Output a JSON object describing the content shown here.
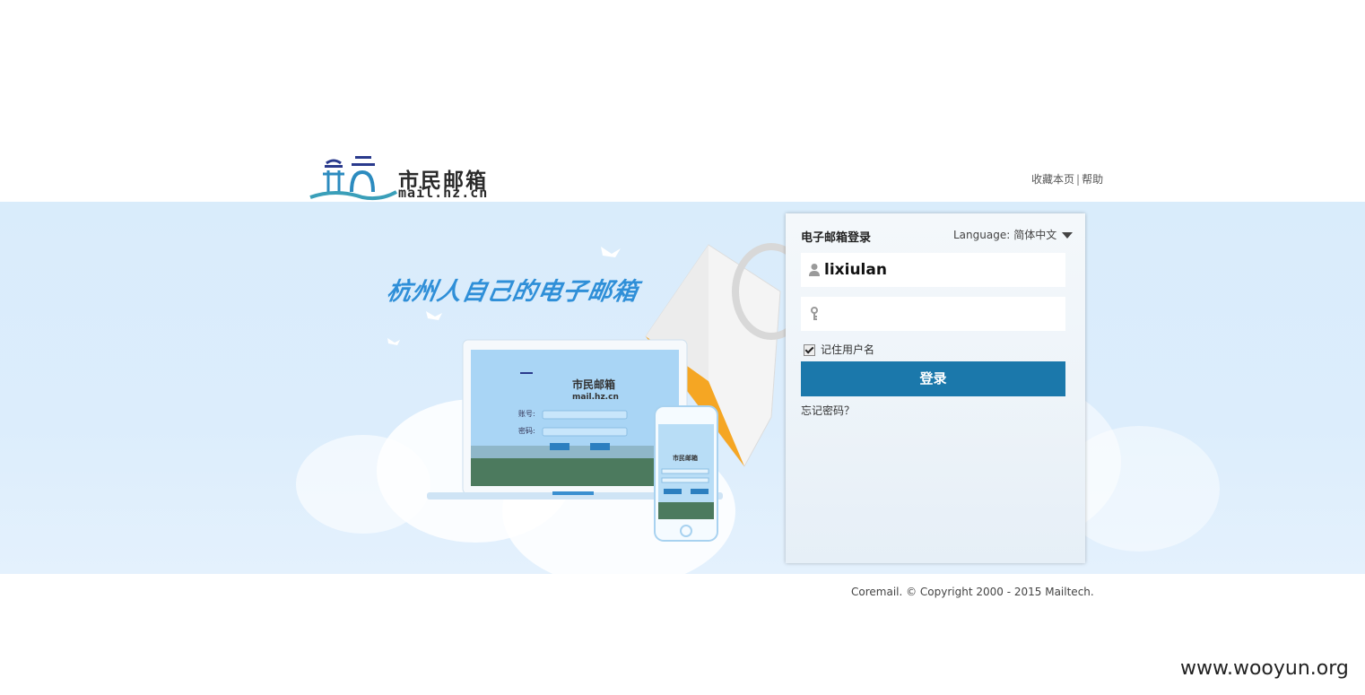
{
  "header": {
    "logo_cn": "市民邮箱",
    "logo_en": "mail.hz.cn",
    "links": [
      "收藏本页",
      "帮助"
    ],
    "separator": "|"
  },
  "banner": {
    "slogan": "杭州人自己的电子邮箱"
  },
  "login": {
    "title": "电子邮箱登录",
    "language_label": "Language:",
    "language_value": "简体中文",
    "username_value": "lixiulan",
    "password_value": "",
    "remember_label": "记住用户名",
    "remember_checked": true,
    "submit_label": "登录",
    "forgot_label": "忘记密码？"
  },
  "footer": {
    "copyright": "Coremail. © Copyright 2000 - 2015 Mailtech."
  },
  "watermark": "www.wooyun.org",
  "colors": {
    "accent": "#1b78ab",
    "banner_bg": "#dcedfc",
    "slogan": "#2f8fd8"
  },
  "icons": [
    "logo-icon",
    "user-icon",
    "key-icon",
    "caret-down-icon",
    "envelope-illustration",
    "laptop-illustration",
    "phone-illustration"
  ]
}
